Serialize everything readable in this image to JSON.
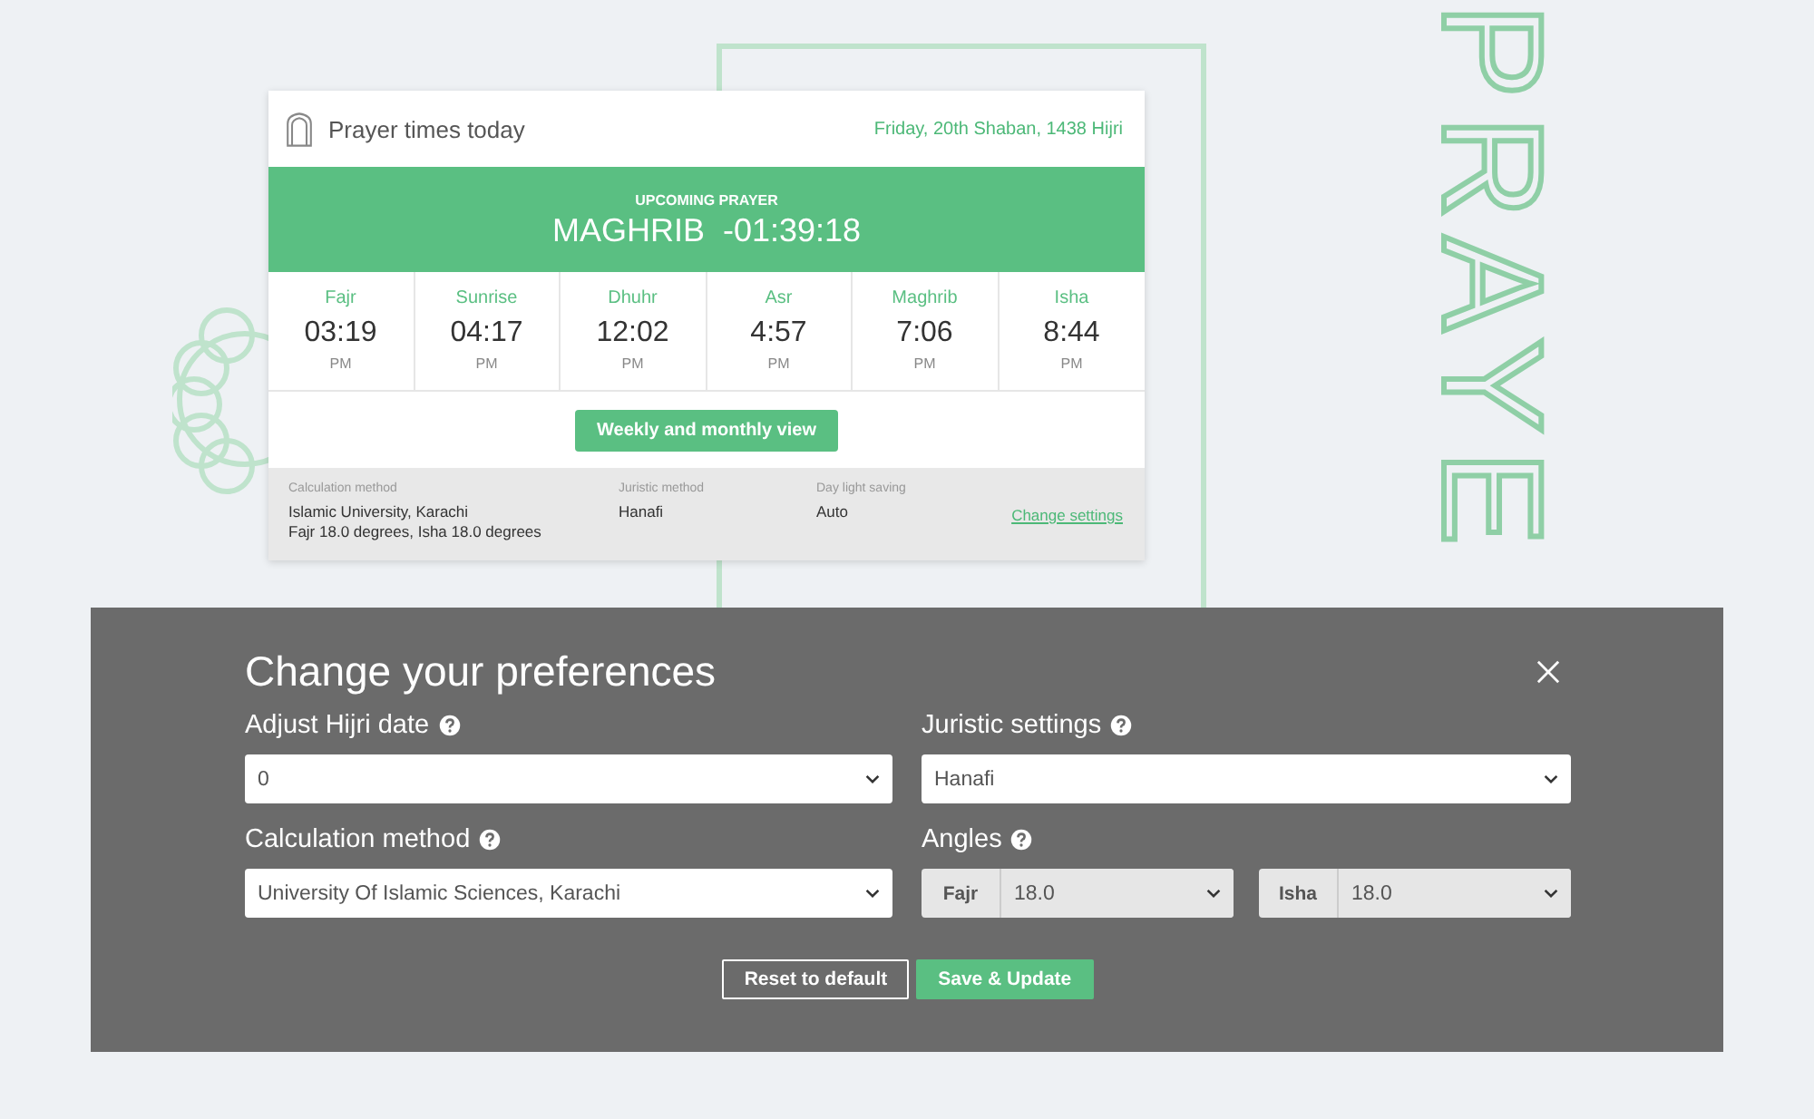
{
  "backdrop_text": [
    {
      "text": "PRAYE",
      "kind": "top"
    }
  ],
  "card": {
    "title": "Prayer times today",
    "date": "Friday, 20th Shaban, 1438 Hijri",
    "upcoming": {
      "label": "UPCOMING PRAYER",
      "value": "MAGHRIB  -01:39:18"
    },
    "times": [
      {
        "name": "Fajr",
        "time": "03:19",
        "period": "PM"
      },
      {
        "name": "Sunrise",
        "time": "04:17",
        "period": "PM"
      },
      {
        "name": "Dhuhr",
        "time": "12:02",
        "period": "PM"
      },
      {
        "name": "Asr",
        "time": "4:57",
        "period": "PM"
      },
      {
        "name": "Maghrib",
        "time": "7:06",
        "period": "PM"
      },
      {
        "name": "Isha",
        "time": "8:44",
        "period": "PM"
      }
    ],
    "view_button": "Weekly and monthly view",
    "settings": [
      {
        "label": "Calculation method",
        "lines": [
          "Islamic University, Karachi",
          "Fajr 18.0 degrees, Isha 18.0 degrees"
        ]
      },
      {
        "label": "Juristic method",
        "lines": [
          "Hanafi"
        ]
      },
      {
        "label": "Day light saving",
        "lines": [
          "Auto"
        ]
      }
    ],
    "change_link": "Change settings"
  },
  "modal": {
    "title": "Change your preferences",
    "fields": [
      {
        "label": "Adjust Hijri date",
        "kind": "select",
        "value": "0"
      },
      {
        "label": "Juristic settings",
        "kind": "select",
        "value": "Hanafi"
      },
      {
        "label": "Calculation method",
        "kind": "select",
        "value": "University Of Islamic Sciences, Karachi"
      },
      {
        "label": "Angles",
        "kind": "angles",
        "angles": [
          {
            "prefix": "Fajr",
            "value": "18.0"
          },
          {
            "prefix": "Isha",
            "value": "18.0"
          }
        ]
      }
    ],
    "buttons": [
      {
        "label": "Reset to default",
        "kind": "outline"
      },
      {
        "label": "Save & Update",
        "kind": "primary"
      }
    ]
  }
}
